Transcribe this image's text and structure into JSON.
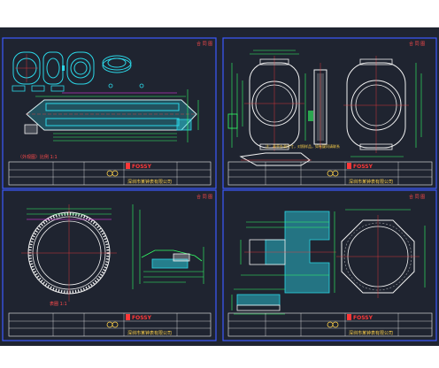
{
  "colors": {
    "background": "#1f2430",
    "sheet_border": "#3d5bff",
    "geometry": "#f2f2f2",
    "dimension": "#33ff66",
    "hatch": "#2bd8e8",
    "center": "#ff3b3b",
    "text": "#ffd24a",
    "magenta": "#ff3cff"
  },
  "sheets": [
    {
      "id": "top-left",
      "caption": "（外观图）比例 1:1",
      "brand": "FOSSY",
      "company": "深圳市某钟表有限公司",
      "stamp": "合 同 图"
    },
    {
      "id": "top-right",
      "note": "注：表壳外观尺寸，对照样品，如有疑问请联系",
      "brand": "FOSSY",
      "company": "深圳市某钟表有限公司",
      "stamp": "合 同 图"
    },
    {
      "id": "bottom-left",
      "caption": "表圈 1:1",
      "brand": "FOSSY",
      "company": "深圳市某钟表有限公司",
      "stamp": "合 同 图"
    },
    {
      "id": "bottom-right",
      "brand": "FOSSY",
      "company": "深圳市某钟表有限公司",
      "stamp": "合 同 图"
    }
  ]
}
